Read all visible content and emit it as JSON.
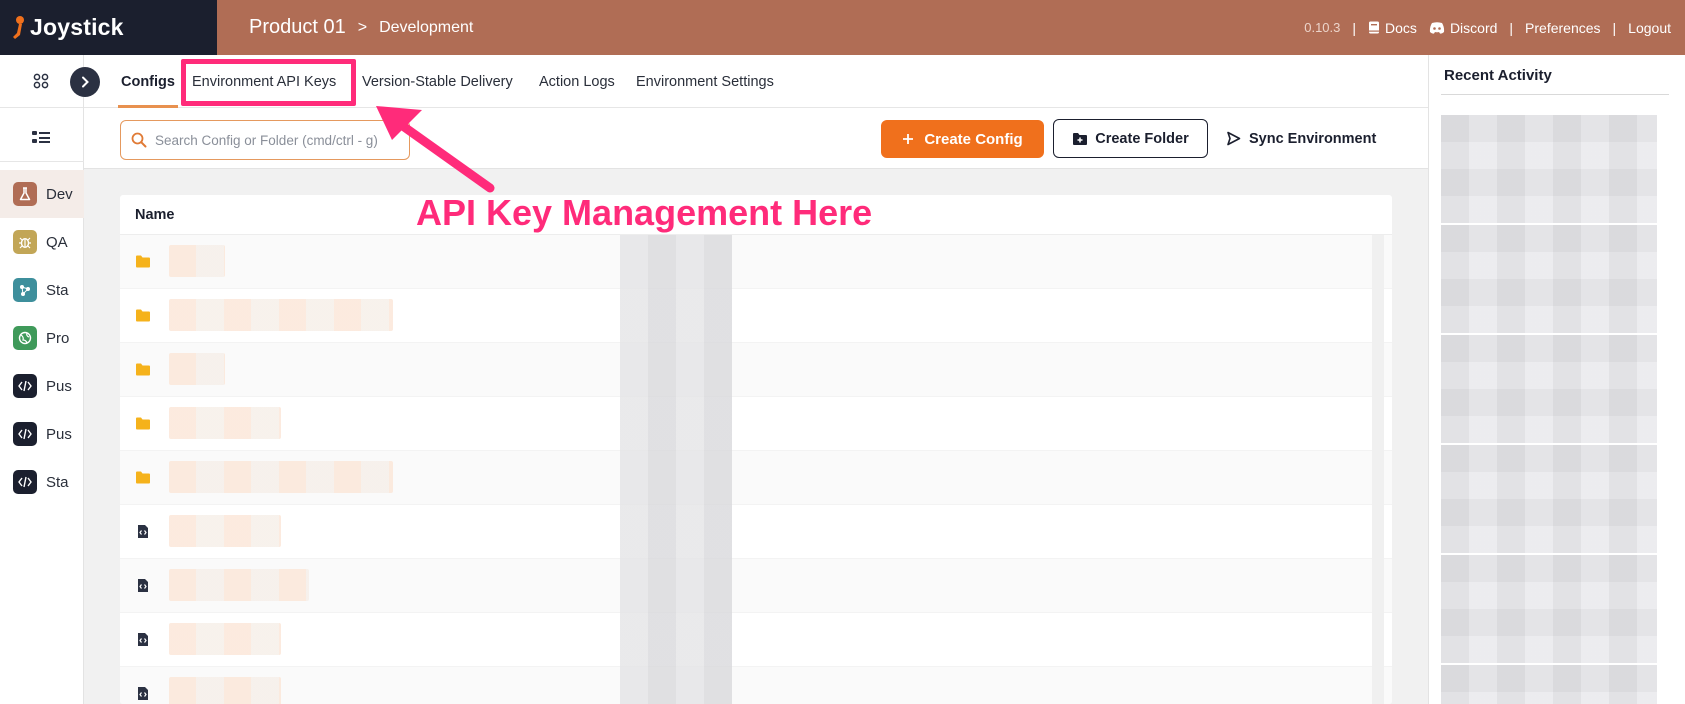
{
  "app": {
    "logo_text": "Joystick",
    "breadcrumb_product": "Product 01",
    "breadcrumb_separator": ">",
    "breadcrumb_env": "Development",
    "version": "0.10.3",
    "separator": "|",
    "links": {
      "docs": "Docs",
      "discord": "Discord",
      "preferences": "Preferences",
      "logout": "Logout"
    },
    "header_color": "#b06d55",
    "accent_color": "#f0701c"
  },
  "sidebar": {
    "envs": [
      {
        "label": "Dev",
        "color": "#b06d55",
        "icon": "flask-icon"
      },
      {
        "label": "QA",
        "color": "#c2a657",
        "icon": "bug-icon"
      },
      {
        "label": "Sta",
        "color": "#3e8f9c",
        "icon": "nodes-icon"
      },
      {
        "label": "Pro",
        "color": "#3f9a5a",
        "icon": "globe-icon"
      },
      {
        "label": "Pus",
        "color": "#1b1f2e",
        "icon": "code-icon"
      },
      {
        "label": "Pus",
        "color": "#1b1f2e",
        "icon": "code-icon"
      },
      {
        "label": "Sta",
        "color": "#1b1f2e",
        "icon": "code-icon"
      }
    ]
  },
  "tabs": [
    {
      "label": "Configs",
      "active": true
    },
    {
      "label": "Environment API Keys"
    },
    {
      "label": "Version-Stable Delivery"
    },
    {
      "label": "Action Logs"
    },
    {
      "label": "Environment Settings"
    }
  ],
  "toolbar": {
    "search_placeholder": "Search Config or Folder (cmd/ctrl - g)",
    "create_config": "Create Config",
    "create_folder": "Create Folder",
    "sync": "Sync Environment"
  },
  "table": {
    "header_name": "Name",
    "rows": [
      {
        "type": "folder"
      },
      {
        "type": "folder"
      },
      {
        "type": "folder"
      },
      {
        "type": "folder"
      },
      {
        "type": "folder"
      },
      {
        "type": "config"
      },
      {
        "type": "config"
      },
      {
        "type": "config"
      },
      {
        "type": "config"
      }
    ]
  },
  "annotation": {
    "text": "API Key Management Here",
    "color": "#ff2b7a"
  },
  "activity": {
    "title": "Recent Activity"
  }
}
